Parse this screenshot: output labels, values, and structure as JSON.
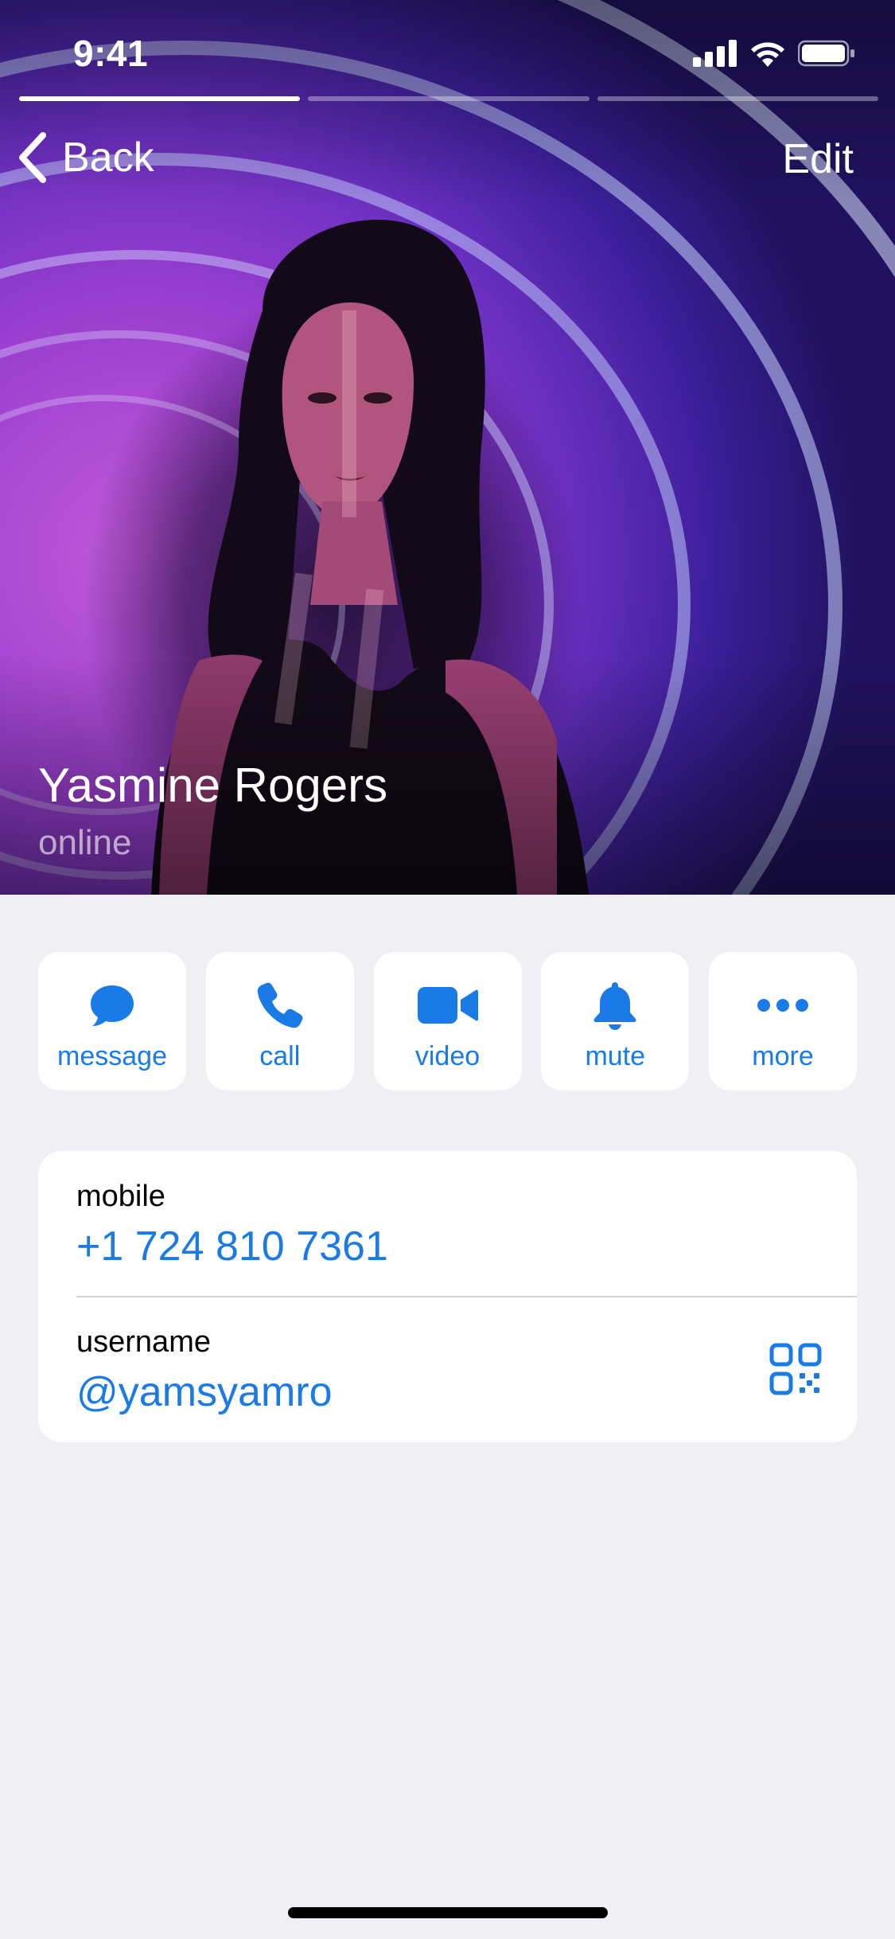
{
  "status_bar": {
    "time": "9:41"
  },
  "story_progress": {
    "total": 3,
    "current": 1
  },
  "nav": {
    "back_label": "Back",
    "edit_label": "Edit"
  },
  "profile": {
    "name": "Yasmine Rogers",
    "status": "online"
  },
  "actions": [
    {
      "label": "message",
      "icon": "chat-bubble-icon"
    },
    {
      "label": "call",
      "icon": "phone-icon"
    },
    {
      "label": "video",
      "icon": "video-camera-icon"
    },
    {
      "label": "mute",
      "icon": "bell-icon"
    },
    {
      "label": "more",
      "icon": "ellipsis-icon"
    }
  ],
  "info": {
    "mobile_label": "mobile",
    "mobile_value": "+1 724 810 7361",
    "username_label": "username",
    "username_value": "@yamsyamro"
  },
  "colors": {
    "accent": "#1a7ae6",
    "background": "#efeff4"
  }
}
